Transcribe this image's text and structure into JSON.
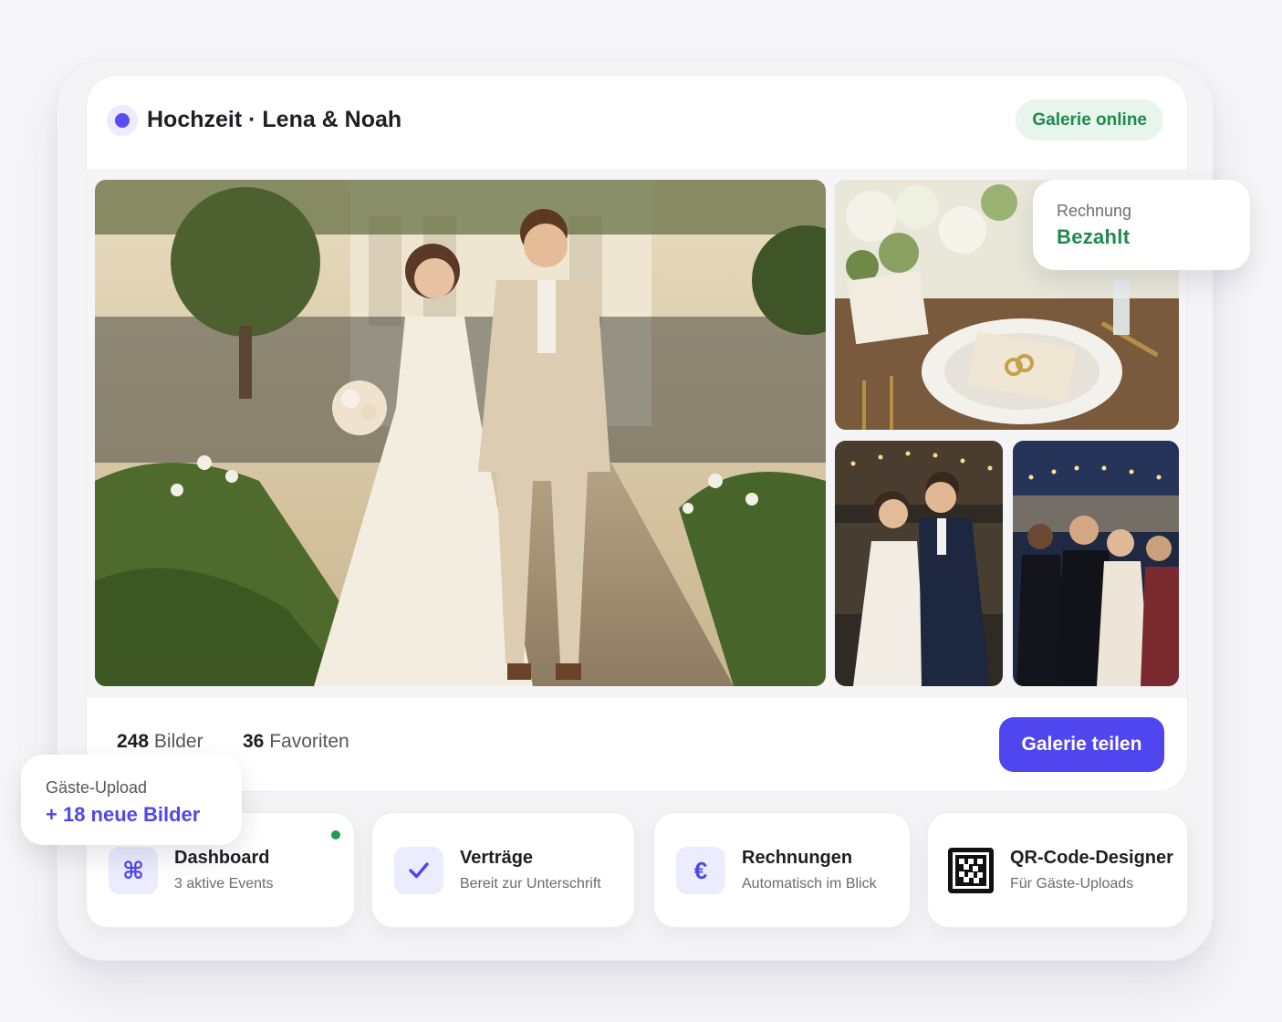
{
  "gallery": {
    "title": "Hochzeit · Lena & Noah",
    "status": "Galerie online",
    "photos": [
      {
        "name": "Brautpaar im Garten"
      },
      {
        "name": "Tischdekoration"
      },
      {
        "name": "Erster Tanz"
      },
      {
        "name": "Gäste feiern"
      }
    ]
  },
  "stats": {
    "images_count": "248",
    "images_label": "Bilder",
    "favorites_count": "36",
    "favorites_label": "Favoriten"
  },
  "actions": {
    "share_label": "Galerie teilen"
  },
  "invoice_badge": {
    "label": "Rechnung",
    "value": "Bezahlt"
  },
  "upload_badge": {
    "label": "Gäste-Upload",
    "value": "+ 18 neue Bilder"
  },
  "tiles": [
    {
      "title": "Dashboard",
      "subtitle": "3 aktive Events",
      "icon": "command-icon"
    },
    {
      "title": "Verträge",
      "subtitle": "Bereit zur Unterschrift",
      "icon": "check-icon"
    },
    {
      "title": "Rechnungen",
      "subtitle": "Automatisch im Blick",
      "icon": "euro-icon"
    },
    {
      "title": "QR-Code-Designer",
      "subtitle": "Für Gäste-Uploads",
      "icon": "qr-code-icon"
    }
  ],
  "colors": {
    "accent": "#5046f0",
    "success": "#1e8a4e",
    "success_bg": "#e7f5ec",
    "icon_bg": "#ececff"
  }
}
